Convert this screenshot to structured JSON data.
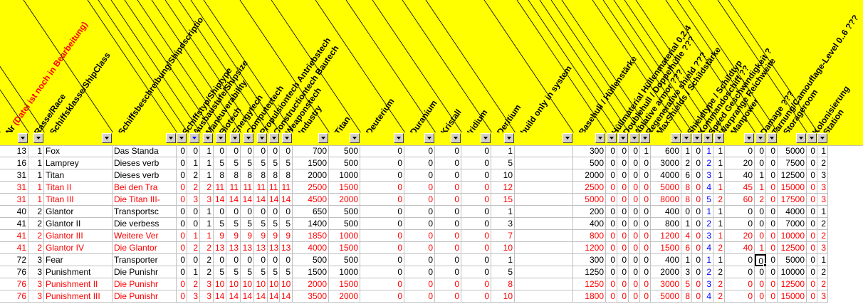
{
  "headers": [
    {
      "key": "c1",
      "label": "Nr",
      "red_note": "(Datei ist noch in Bearbeitung)"
    },
    {
      "key": "c2",
      "label": "Rasse/Race"
    },
    {
      "key": "c3",
      "label": "Schiffsklasse/ShipClass"
    },
    {
      "key": "c4",
      "label": "Schiffsbeschreibung/Shipdscriptio"
    },
    {
      "key": "c5",
      "label": "Schiffstyp/Shiptype"
    },
    {
      "key": "c6",
      "label": "Ausbaustufe/Shipsize"
    },
    {
      "key": "c7",
      "label": "Maneuverability"
    },
    {
      "key": "c8",
      "label": "Biotech"
    },
    {
      "key": "c9",
      "label": "Energytech"
    },
    {
      "key": "c10",
      "label": "Computertech"
    },
    {
      "key": "c11",
      "label": "Propulsiontech Antriebstech"
    },
    {
      "key": "c12",
      "label": "Constructiontech Bautech"
    },
    {
      "key": "c13",
      "label": "Weaponstech"
    },
    {
      "key": "c14",
      "label": "Industry"
    },
    {
      "key": "c15",
      "label": "Titan"
    },
    {
      "key": "c16",
      "label": "Deuterium"
    },
    {
      "key": "c17",
      "label": "Duranium"
    },
    {
      "key": "c18",
      "label": "Kristall"
    },
    {
      "key": "c19",
      "label": "Iridium"
    },
    {
      "key": "c20",
      "label": "Deritium"
    },
    {
      "key": "c21",
      "label": "build only in system"
    },
    {
      "key": "c22",
      "label": "Basehull / Hüllenstärke"
    },
    {
      "key": "c23",
      "label": "Hüllmaterial Hüllenmaterial 0,2,4"
    },
    {
      "key": "c24",
      "label": "Doublehull / Doppelhülle ???"
    },
    {
      "key": "c25",
      "label": "Ablative armor ???"
    },
    {
      "key": "c26",
      "label": "Regenerative shield ???"
    },
    {
      "key": "c27",
      "label": "MaxShields / Schildstärke"
    },
    {
      "key": "c28",
      "label": "Shieldtype / Schildtyp"
    },
    {
      "key": "c29",
      "label": "Kommandoschiff ??"
    },
    {
      "key": "c30",
      "label": "Speed Geschwindigkeit ?"
    },
    {
      "key": "c31",
      "label": "Warprange Reichweite"
    },
    {
      "key": "c32",
      "label": "Manpower"
    },
    {
      "key": "c33",
      "label": "Damage ???"
    },
    {
      "key": "c34",
      "label": "Tarnung/Camouflage-Level 0..6 ???"
    },
    {
      "key": "c35",
      "label": "Storageroom"
    },
    {
      "key": "c36",
      "label": "Kolonisierung"
    },
    {
      "key": "c37",
      "label": "Station"
    }
  ],
  "rows": [
    {
      "red": false,
      "cells": [
        "13",
        "1",
        "Fox",
        "Das Standa",
        "0",
        "0",
        "1",
        "0",
        "0",
        "0",
        "0",
        "0",
        "0",
        "700",
        "500",
        "0",
        "0",
        "0",
        "0",
        "1",
        "",
        "300",
        "0",
        "0",
        "0",
        "1",
        "600",
        "1",
        "0",
        "1",
        "1",
        "0",
        "0",
        "0",
        "5000",
        "0",
        "1"
      ],
      "blue_col": 29
    },
    {
      "red": false,
      "cells": [
        "16",
        "1",
        "Lamprey",
        "Dieses verb",
        "0",
        "1",
        "1",
        "5",
        "5",
        "5",
        "5",
        "5",
        "5",
        "1500",
        "500",
        "0",
        "0",
        "0",
        "0",
        "5",
        "",
        "500",
        "0",
        "0",
        "0",
        "0",
        "3000",
        "2",
        "0",
        "2",
        "1",
        "20",
        "0",
        "0",
        "7500",
        "0",
        "2"
      ],
      "blue_col": 29
    },
    {
      "red": false,
      "cells": [
        "31",
        "1",
        "Titan",
        "Dieses verb",
        "0",
        "2",
        "1",
        "8",
        "8",
        "8",
        "8",
        "8",
        "8",
        "2000",
        "1000",
        "0",
        "0",
        "0",
        "0",
        "10",
        "",
        "2000",
        "0",
        "0",
        "0",
        "0",
        "4000",
        "6",
        "0",
        "3",
        "1",
        "40",
        "1",
        "0",
        "12500",
        "0",
        "3"
      ],
      "blue_col": 29
    },
    {
      "red": true,
      "cells": [
        "31",
        "1",
        "Titan II",
        "Bei den Tra",
        "0",
        "2",
        "2",
        "11",
        "11",
        "11",
        "11",
        "11",
        "11",
        "2500",
        "1500",
        "0",
        "0",
        "0",
        "0",
        "12",
        "",
        "2500",
        "0",
        "0",
        "0",
        "0",
        "5000",
        "8",
        "0",
        "4",
        "1",
        "45",
        "1",
        "0",
        "15000",
        "0",
        "3"
      ],
      "blue_col": 29
    },
    {
      "red": true,
      "cells": [
        "31",
        "1",
        "Titan III",
        "Die Titan III-",
        "0",
        "3",
        "3",
        "14",
        "14",
        "14",
        "14",
        "14",
        "14",
        "4500",
        "2000",
        "0",
        "0",
        "0",
        "0",
        "15",
        "",
        "5000",
        "0",
        "0",
        "0",
        "0",
        "8000",
        "8",
        "0",
        "5",
        "2",
        "60",
        "2",
        "0",
        "17500",
        "0",
        "3"
      ],
      "blue_col": 29
    },
    {
      "red": false,
      "cells": [
        "40",
        "2",
        "Glantor",
        "Transportsc",
        "0",
        "0",
        "1",
        "0",
        "0",
        "0",
        "0",
        "0",
        "0",
        "650",
        "500",
        "0",
        "0",
        "0",
        "0",
        "1",
        "",
        "200",
        "0",
        "0",
        "0",
        "0",
        "400",
        "0",
        "0",
        "1",
        "1",
        "0",
        "0",
        "0",
        "4000",
        "0",
        "1"
      ],
      "blue_col": 29
    },
    {
      "red": false,
      "cells": [
        "41",
        "2",
        "Glantor II",
        "Die verbess",
        "0",
        "0",
        "1",
        "5",
        "5",
        "5",
        "5",
        "5",
        "5",
        "1400",
        "500",
        "0",
        "0",
        "0",
        "0",
        "3",
        "",
        "400",
        "0",
        "0",
        "0",
        "0",
        "800",
        "1",
        "0",
        "2",
        "1",
        "0",
        "0",
        "0",
        "7000",
        "0",
        "2"
      ],
      "blue_col": 29
    },
    {
      "red": true,
      "cells": [
        "41",
        "2",
        "Glantor III",
        "Weitere Ver",
        "0",
        "1",
        "1",
        "9",
        "9",
        "9",
        "9",
        "9",
        "9",
        "1850",
        "1000",
        "0",
        "0",
        "0",
        "0",
        "7",
        "",
        "800",
        "0",
        "0",
        "0",
        "0",
        "1200",
        "4",
        "0",
        "3",
        "1",
        "20",
        "0",
        "0",
        "10000",
        "0",
        "2"
      ],
      "blue_col": 29
    },
    {
      "red": true,
      "cells": [
        "41",
        "2",
        "Glantor IV",
        "Die Glantor",
        "0",
        "2",
        "2",
        "13",
        "13",
        "13",
        "13",
        "13",
        "13",
        "4000",
        "1500",
        "0",
        "0",
        "0",
        "0",
        "10",
        "",
        "1200",
        "0",
        "0",
        "0",
        "0",
        "1500",
        "6",
        "0",
        "4",
        "2",
        "40",
        "1",
        "0",
        "12500",
        "0",
        "3"
      ],
      "blue_col": 29
    },
    {
      "red": false,
      "cells": [
        "72",
        "3",
        "Fear",
        "Transporter",
        "0",
        "0",
        "2",
        "0",
        "0",
        "0",
        "0",
        "0",
        "0",
        "500",
        "500",
        "0",
        "0",
        "0",
        "0",
        "1",
        "",
        "300",
        "0",
        "0",
        "0",
        "0",
        "400",
        "1",
        "0",
        "1",
        "1",
        "0",
        "0",
        "0",
        "5000",
        "0",
        "1"
      ],
      "blue_col": 29,
      "selected_col": 32
    },
    {
      "red": false,
      "cells": [
        "76",
        "3",
        "Punishment",
        "Die Punishr",
        "0",
        "1",
        "2",
        "5",
        "5",
        "5",
        "5",
        "5",
        "5",
        "1500",
        "1000",
        "0",
        "0",
        "0",
        "0",
        "5",
        "",
        "1250",
        "0",
        "0",
        "0",
        "0",
        "2000",
        "3",
        "0",
        "2",
        "2",
        "0",
        "0",
        "0",
        "10000",
        "0",
        "2"
      ],
      "blue_col": 29
    },
    {
      "red": true,
      "cells": [
        "76",
        "3",
        "Punishment II",
        "Die Punishr",
        "0",
        "2",
        "3",
        "10",
        "10",
        "10",
        "10",
        "10",
        "10",
        "2000",
        "1500",
        "0",
        "0",
        "0",
        "0",
        "8",
        "",
        "1250",
        "0",
        "0",
        "0",
        "0",
        "3000",
        "5",
        "0",
        "3",
        "2",
        "0",
        "0",
        "0",
        "12500",
        "0",
        "2"
      ],
      "blue_col": 29
    },
    {
      "red": true,
      "cells": [
        "76",
        "3",
        "Punishment III",
        "Die Punishr",
        "0",
        "3",
        "3",
        "14",
        "14",
        "14",
        "14",
        "14",
        "14",
        "3500",
        "2000",
        "0",
        "0",
        "0",
        "0",
        "10",
        "",
        "1800",
        "0",
        "0",
        "0",
        "0",
        "5000",
        "8",
        "0",
        "4",
        "2",
        "0",
        "0",
        "0",
        "15000",
        "0",
        "3"
      ],
      "blue_col": 29
    }
  ],
  "active_filter_col": 5,
  "colors": {
    "header_bg": "#ffff00",
    "red_text": "#ff0000",
    "blue_text": "#0000ff",
    "grid": "#c0c0c0"
  },
  "icons": {
    "filter_button": "dropdown-arrow-icon",
    "fill_handle": "fill-handle-icon"
  }
}
